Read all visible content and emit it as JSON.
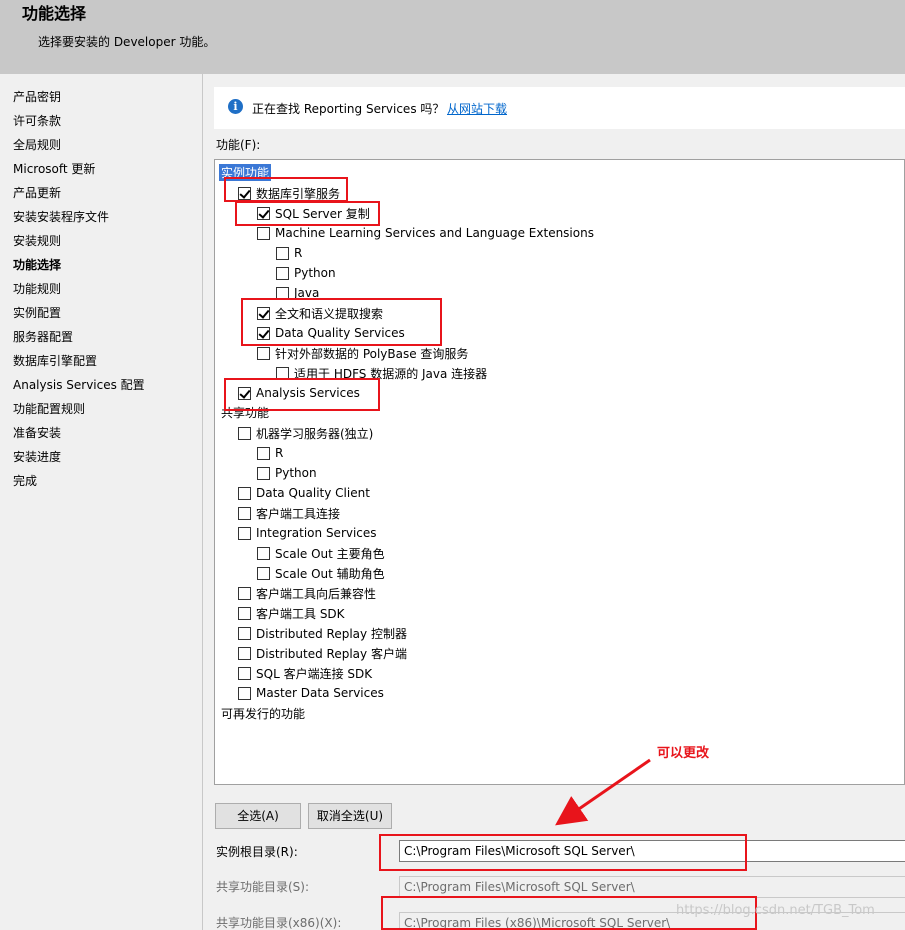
{
  "header": {
    "title": "功能选择",
    "subtitle": "选择要安装的 Developer 功能。"
  },
  "sidebar": {
    "items": [
      {
        "label": "产品密钥"
      },
      {
        "label": "许可条款"
      },
      {
        "label": "全局规则"
      },
      {
        "label": "Microsoft 更新"
      },
      {
        "label": "产品更新"
      },
      {
        "label": "安装安装程序文件"
      },
      {
        "label": "安装规则"
      },
      {
        "label": "功能选择",
        "active": true
      },
      {
        "label": "功能规则"
      },
      {
        "label": "实例配置"
      },
      {
        "label": "服务器配置"
      },
      {
        "label": "数据库引擎配置"
      },
      {
        "label": "Analysis Services 配置"
      },
      {
        "label": "功能配置规则"
      },
      {
        "label": "准备安装"
      },
      {
        "label": "安装进度"
      },
      {
        "label": "完成"
      }
    ]
  },
  "info": {
    "icon": "info-icon",
    "text": "正在查找 Reporting Services 吗？",
    "link": "从网站下载"
  },
  "features": {
    "label": "功能(F):",
    "instance_header": "实例功能",
    "shared_header": "共享功能",
    "redistributable_header": "可再发行的功能",
    "items": [
      {
        "label": "数据库引擎服务",
        "checked": true
      },
      {
        "label": "SQL Server 复制",
        "checked": true
      },
      {
        "label": "Machine Learning Services and Language Extensions",
        "checked": false
      },
      {
        "label": "R",
        "checked": false
      },
      {
        "label": "Python",
        "checked": false
      },
      {
        "label": "Java",
        "checked": false
      },
      {
        "label": "全文和语义提取搜索",
        "checked": true
      },
      {
        "label": "Data Quality Services",
        "checked": true
      },
      {
        "label": "针对外部数据的 PolyBase 查询服务",
        "checked": false
      },
      {
        "label": "适用于 HDFS 数据源的 Java 连接器",
        "checked": false
      },
      {
        "label": "Analysis Services",
        "checked": true
      },
      {
        "label": "机器学习服务器(独立)",
        "checked": false
      },
      {
        "label": "R",
        "checked": false
      },
      {
        "label": "Python",
        "checked": false
      },
      {
        "label": "Data Quality Client",
        "checked": false
      },
      {
        "label": "客户端工具连接",
        "checked": false
      },
      {
        "label": "Integration Services",
        "checked": false
      },
      {
        "label": "Scale Out 主要角色",
        "checked": false
      },
      {
        "label": "Scale Out 辅助角色",
        "checked": false
      },
      {
        "label": "客户端工具向后兼容性",
        "checked": false
      },
      {
        "label": "客户端工具 SDK",
        "checked": false
      },
      {
        "label": "Distributed Replay 控制器",
        "checked": false
      },
      {
        "label": "Distributed Replay 客户端",
        "checked": false
      },
      {
        "label": "SQL 客户端连接 SDK",
        "checked": false
      },
      {
        "label": "Master Data Services",
        "checked": false
      }
    ]
  },
  "buttons": {
    "select_all": "全选(A)",
    "unselect_all": "取消全选(U)"
  },
  "fields": {
    "instance_root_label": "实例根目录(R):",
    "instance_root_value": "C:\\Program Files\\Microsoft SQL Server\\",
    "shared_dir_label": "共享功能目录(S):",
    "shared_dir_value": "C:\\Program Files\\Microsoft SQL Server\\",
    "shared_dir_x86_label": "共享功能目录(x86)(X):",
    "shared_dir_x86_value": "C:\\Program Files (x86)\\Microsoft SQL Server\\"
  },
  "annotation": {
    "text": "可以更改",
    "color": "#e8141b"
  },
  "watermark": "https://blog.csdn.net/TGB_Tom"
}
